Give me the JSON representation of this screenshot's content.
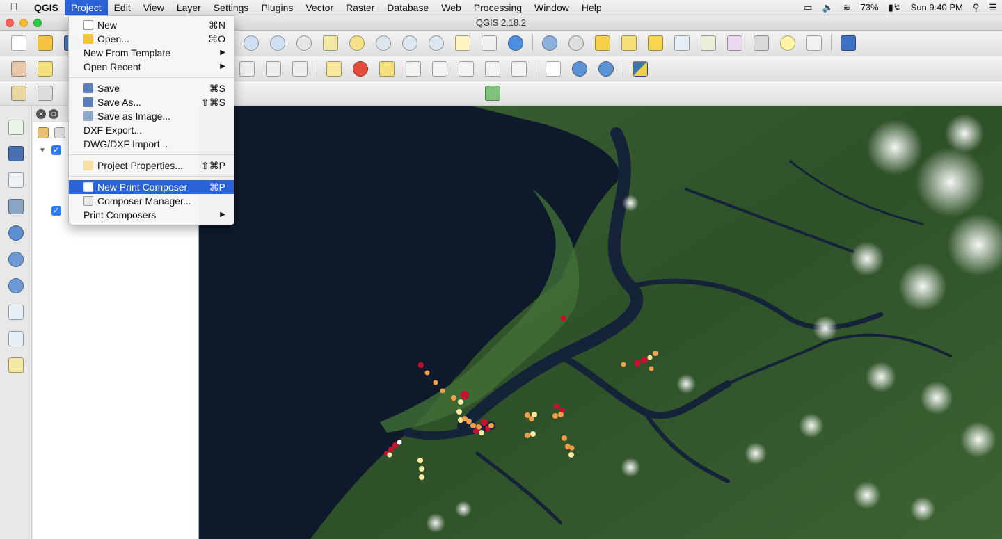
{
  "menubar": {
    "app": "QGIS",
    "items": [
      "Project",
      "Edit",
      "View",
      "Layer",
      "Settings",
      "Plugins",
      "Vector",
      "Raster",
      "Database",
      "Web",
      "Processing",
      "Window",
      "Help"
    ],
    "battery": "73%",
    "clock": "Sun 9:40 PM"
  },
  "window": {
    "title": "QGIS 2.18.2"
  },
  "project_menu": {
    "items": [
      {
        "label": "New",
        "shortcut": "⌘N"
      },
      {
        "label": "Open...",
        "shortcut": "⌘O"
      },
      {
        "label": "New From Template",
        "submenu": true
      },
      {
        "label": "Open Recent",
        "submenu": true
      },
      {
        "label": "Save",
        "shortcut": "⌘S"
      },
      {
        "label": "Save As...",
        "shortcut": "⇧⌘S"
      },
      {
        "label": "Save as Image..."
      },
      {
        "label": "DXF Export..."
      },
      {
        "label": "DWG/DXF Import..."
      },
      {
        "label": "Project Properties...",
        "shortcut": "⇧⌘P"
      },
      {
        "label": "New Print Composer",
        "shortcut": "⌘P",
        "highlighted": true
      },
      {
        "label": "Composer Manager..."
      },
      {
        "label": "Print Composers",
        "submenu": true
      }
    ]
  },
  "colors": {
    "highlight": "#2a62d8",
    "points_red": "#c8102e",
    "points_orange": "#f39c4a",
    "points_yellow": "#ffe9a0"
  }
}
